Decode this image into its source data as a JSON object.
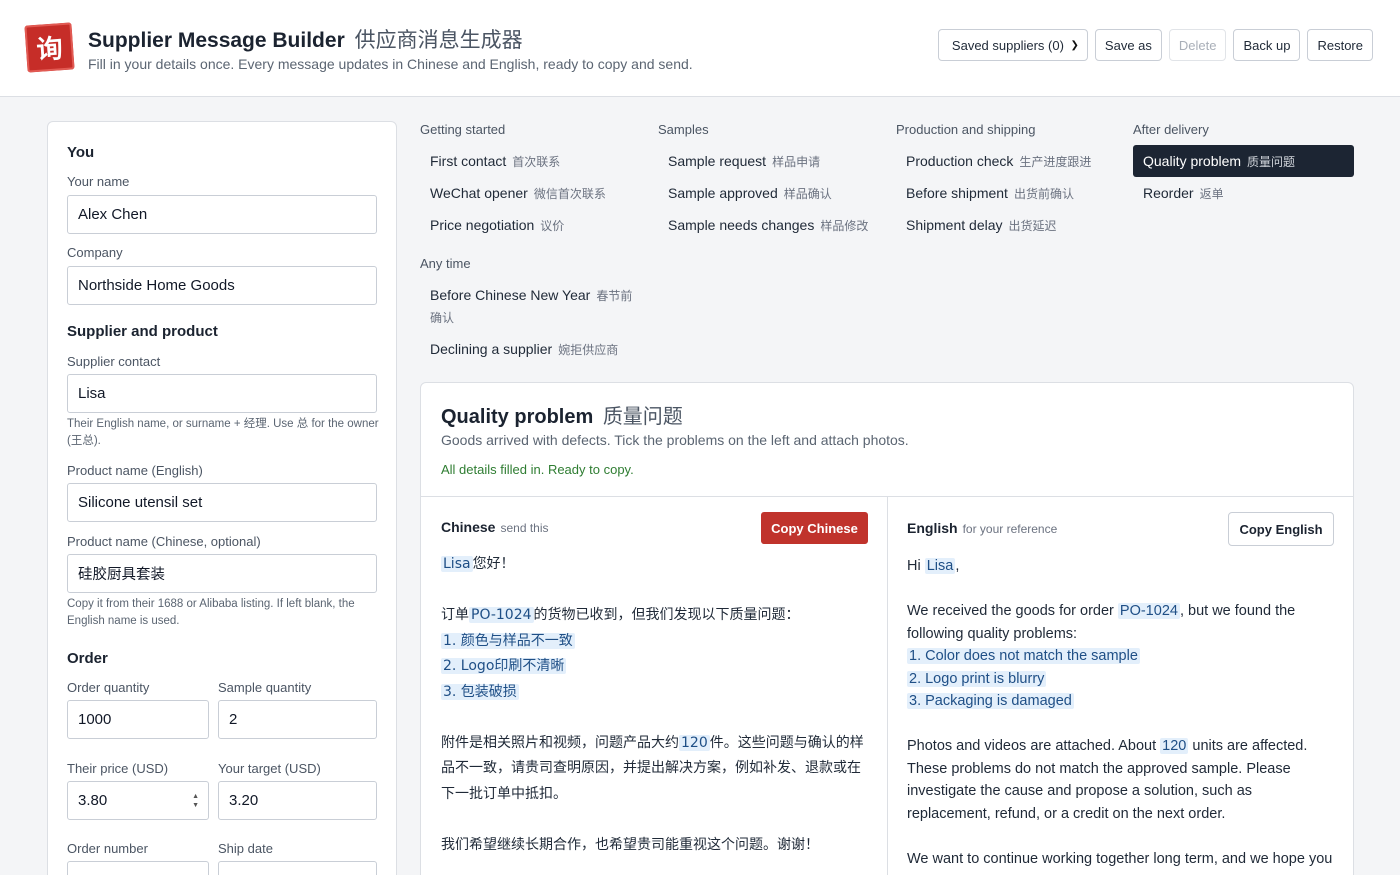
{
  "header": {
    "logo_char": "询",
    "title": "Supplier Message Builder",
    "title_zh": "供应商消息生成器",
    "subtitle": "Fill in your details once. Every message updates in Chinese and English, ready to copy and send.",
    "saved_select": "Saved suppliers (0)",
    "save_as": "Save as",
    "delete": "Delete",
    "back_up": "Back up",
    "restore": "Restore"
  },
  "form": {
    "you_title": "You",
    "your_name_label": "Your name",
    "your_name": "Alex Chen",
    "company_label": "Company",
    "company": "Northside Home Goods",
    "supplier_title": "Supplier and product",
    "contact_label": "Supplier contact",
    "contact": "Lisa",
    "contact_hint": "Their English name, or surname + 经理. Use 总 for the owner (王总).",
    "product_en_label": "Product name (English)",
    "product_en": "Silicone utensil set",
    "product_zh_label": "Product name (Chinese, optional)",
    "product_zh": "硅胶厨具套装",
    "product_zh_hint": "Copy it from their 1688 or Alibaba listing. If left blank, the English name is used.",
    "order_title": "Order",
    "order_qty_label": "Order quantity",
    "order_qty": "1000",
    "sample_qty_label": "Sample quantity",
    "sample_qty": "2",
    "their_price_label": "Their price (USD)",
    "their_price": "3.80",
    "target_label": "Your target (USD)",
    "target": "3.20",
    "order_no_label": "Order number",
    "ship_date_label": "Ship date"
  },
  "nav": {
    "groups": {
      "getting_started": "Getting started",
      "samples": "Samples",
      "production": "Production and shipping",
      "after": "After delivery",
      "any": "Any time"
    },
    "items": {
      "first_contact": {
        "en": "First contact",
        "zh": "首次联系"
      },
      "wechat": {
        "en": "WeChat opener",
        "zh": "微信首次联系"
      },
      "price": {
        "en": "Price negotiation",
        "zh": "议价"
      },
      "sample_request": {
        "en": "Sample request",
        "zh": "样品申请"
      },
      "sample_approved": {
        "en": "Sample approved",
        "zh": "样品确认"
      },
      "sample_changes": {
        "en": "Sample needs changes",
        "zh": "样品修改"
      },
      "production_check": {
        "en": "Production check",
        "zh": "生产进度跟进"
      },
      "before_shipment": {
        "en": "Before shipment",
        "zh": "出货前确认"
      },
      "shipment_delay": {
        "en": "Shipment delay",
        "zh": "出货延迟"
      },
      "quality": {
        "en": "Quality problem",
        "zh": "质量问题"
      },
      "reorder": {
        "en": "Reorder",
        "zh": "返单"
      },
      "cny": {
        "en": "Before Chinese New Year",
        "zh": "春节前确认"
      },
      "declining": {
        "en": "Declining a supplier",
        "zh": "婉拒供应商"
      }
    }
  },
  "card": {
    "title": "Quality problem",
    "title_zh": "质量问题",
    "description": "Goods arrived with defects. Tick the problems on the left and attach photos.",
    "status": "All details filled in. Ready to copy.",
    "zh_head": "Chinese",
    "zh_sub": "send this",
    "copy_zh": "Copy Chinese",
    "en_head": "English",
    "en_sub": "for your reference",
    "copy_en": "Copy English"
  },
  "message_zh": {
    "name": "Lisa",
    "greet_tail": "您好！",
    "l2_pre": "订单",
    "order": "PO-1024",
    "l2_post": "的货物已收到，但我们发现以下质量问题：",
    "issue1": "1. 颜色与样品不一致",
    "issue2": "2. Logo印刷不清晰",
    "issue3": "3. 包装破损",
    "p3_pre": "附件是相关照片和视频，问题产品大约",
    "qty": "120",
    "p3_post": "件。这些问题与确认的样品不一致，请贵司查明原因，并提出解决方案，例如补发、退款或在下一批订单中抵扣。",
    "closing": "我们希望继续长期合作，也希望贵司能重视这个问题。谢谢！"
  },
  "message_en": {
    "hi": "Hi",
    "name": "Lisa",
    "comma": ",",
    "p2_pre": "We received the goods for order",
    "order": "PO-1024",
    "p2_post": ", but we found the following quality problems:",
    "issue1": "1. Color does not match the sample",
    "issue2": "2. Logo print is blurry",
    "issue3": "3. Packaging is damaged",
    "p3_pre": "Photos and videos are attached. About",
    "qty": "120",
    "p3_post": "units are affected. These problems do not match the approved sample. Please investigate the cause and propose a solution, such as replacement, refund, or a credit on the next order.",
    "closing": "We want to continue working together long term, and we hope you"
  }
}
